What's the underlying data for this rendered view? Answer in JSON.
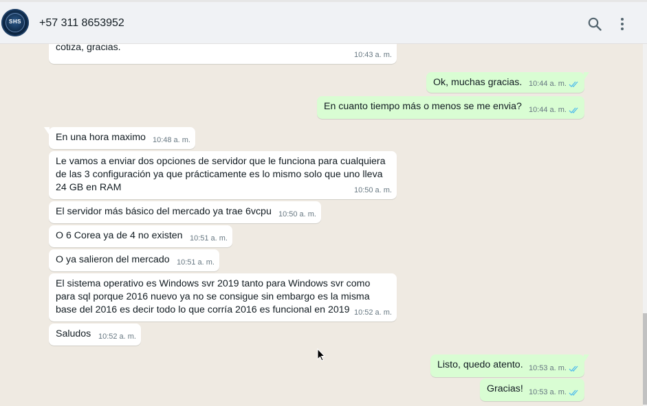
{
  "header": {
    "avatar_text": "SHS",
    "contact": "+57 311 8653952",
    "search_icon": "search-icon",
    "menu_icon": "more-vertical-icon"
  },
  "colors": {
    "incoming_bubble": "#ffffff",
    "outgoing_bubble": "#d9fdd3",
    "chat_background": "#efeae2",
    "read_ticks": "#53bdeb"
  },
  "messages": [
    {
      "dir": "in",
      "text": "cotiza, gracias.",
      "time": "10:43 a. m."
    },
    {
      "dir": "out",
      "text": "Ok, muchas gracias.",
      "time": "10:44 a. m.",
      "status": "read"
    },
    {
      "dir": "out",
      "text": "En cuanto tiempo más o menos se me envia?",
      "time": "10:44 a. m.",
      "status": "read"
    },
    {
      "dir": "in",
      "text": "En una hora maximo",
      "time": "10:48 a. m."
    },
    {
      "dir": "in",
      "text": "Le vamos a enviar dos opciones de servidor que le funciona para cualquiera de las 3 configuración ya que prácticamente es lo mismo solo que uno lleva 24 GB en RAM",
      "time": "10:50 a. m."
    },
    {
      "dir": "in",
      "text": "El servidor más básico del mercado ya trae 6vcpu",
      "time": "10:50 a. m."
    },
    {
      "dir": "in",
      "text": "O 6 Corea ya de 4 no existen",
      "time": "10:51 a. m."
    },
    {
      "dir": "in",
      "text": "O ya salieron del mercado",
      "time": "10:51 a. m."
    },
    {
      "dir": "in",
      "text": "El sistema operativo es Windows svr 2019 tanto para Windows svr como para sql porque 2016 nuevo ya no se consigue sin embargo es la misma base del 2016 es decir todo lo que corría 2016 es funcional en 2019",
      "time": "10:52 a. m."
    },
    {
      "dir": "in",
      "text": "Saludos",
      "time": "10:52 a. m."
    },
    {
      "dir": "out",
      "text": "Listo, quedo atento.",
      "time": "10:53 a. m.",
      "status": "read"
    },
    {
      "dir": "out",
      "text": "Gracias!",
      "time": "10:53 a. m.",
      "status": "read"
    }
  ]
}
